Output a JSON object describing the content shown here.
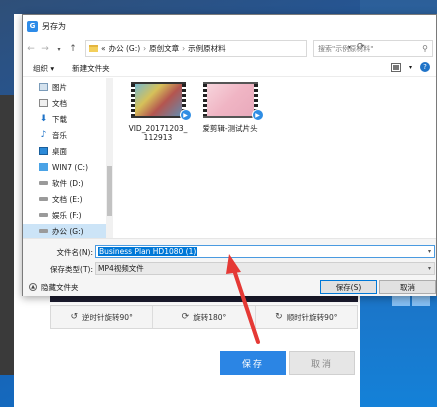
{
  "dialog": {
    "title": "另存为",
    "app_icon_letter": "G",
    "breadcrumb": {
      "overflow": "«",
      "items": [
        "办公 (G:)",
        "原创文章",
        "示例原材料"
      ]
    },
    "search_placeholder": "搜索\"示例原材料\"",
    "toolbar": {
      "organize": "组织 ▾",
      "new_folder": "新建文件夹"
    },
    "nav_items": [
      {
        "label": "图片",
        "icon": "pictures-icon"
      },
      {
        "label": "文档",
        "icon": "documents-icon"
      },
      {
        "label": "下载",
        "icon": "download-icon"
      },
      {
        "label": "音乐",
        "icon": "music-icon"
      },
      {
        "label": "桌面",
        "icon": "desktop-icon"
      },
      {
        "label": "WIN7 (C:)",
        "icon": "windows-drive-icon"
      },
      {
        "label": "软件 (D:)",
        "icon": "drive-icon"
      },
      {
        "label": "文档 (E:)",
        "icon": "drive-icon"
      },
      {
        "label": "娱乐 (F:)",
        "icon": "drive-icon"
      },
      {
        "label": "办公 (G:)",
        "icon": "drive-icon",
        "selected": true
      }
    ],
    "files": [
      {
        "name_line1": "VID_20171203_",
        "name_line2": "112913"
      },
      {
        "name_line1": "爱剪辑-测试片头",
        "name_line2": ""
      }
    ],
    "filename_label": "文件名(N):",
    "filename_value": "Business Plan HD1080 (1)",
    "filetype_label": "保存类型(T):",
    "filetype_value": "MP4视频文件",
    "hide_folders": "隐藏文件夹",
    "save_button": "保存(S)",
    "cancel_button": "取消"
  },
  "background_app": {
    "rotate_buttons": [
      {
        "label": "逆时针旋转90°",
        "icon": "rotate-ccw-icon"
      },
      {
        "label": "旋转180°",
        "icon": "rotate-180-icon"
      },
      {
        "label": "顺时针旋转90°",
        "icon": "rotate-cw-icon"
      }
    ],
    "save_button": "保存",
    "cancel_button": "取消"
  },
  "colors": {
    "accent_blue": "#2b85e4",
    "selection_blue": "#0078d7",
    "annotation_arrow_red": "#e53935"
  }
}
